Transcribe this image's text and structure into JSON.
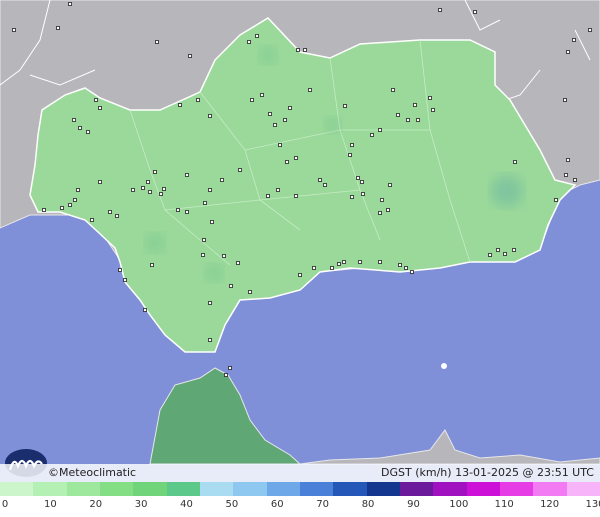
{
  "footer": {
    "brand": "©Meteoclimatic",
    "caption": "DGST (km/h)   13-01-2025 @ 23:51 UTC"
  },
  "legend": {
    "ticks": [
      "0",
      "10",
      "20",
      "30",
      "40",
      "50",
      "60",
      "70",
      "80",
      "90",
      "100",
      "110",
      "120",
      "130"
    ],
    "colors": [
      "#ccf5cc",
      "#b4efb4",
      "#9de89d",
      "#84df84",
      "#6fd47a",
      "#5cc88a",
      "#a9dcf0",
      "#8ec7f0",
      "#6fa8e8",
      "#4a80d8",
      "#2457b8",
      "#15368f",
      "#6a1a9a",
      "#a012c0",
      "#cc10d8",
      "#e63ce6",
      "#f27af2",
      "#f8b4f8"
    ]
  },
  "colors": {
    "sea": "#7f8fd8",
    "land_outside": "#b4b4b8",
    "region": "#9ad99a",
    "africa": "#5fa875"
  },
  "icons": {
    "logo": "meteoclimatic-logo-icon",
    "station": "station-marker-icon"
  }
}
